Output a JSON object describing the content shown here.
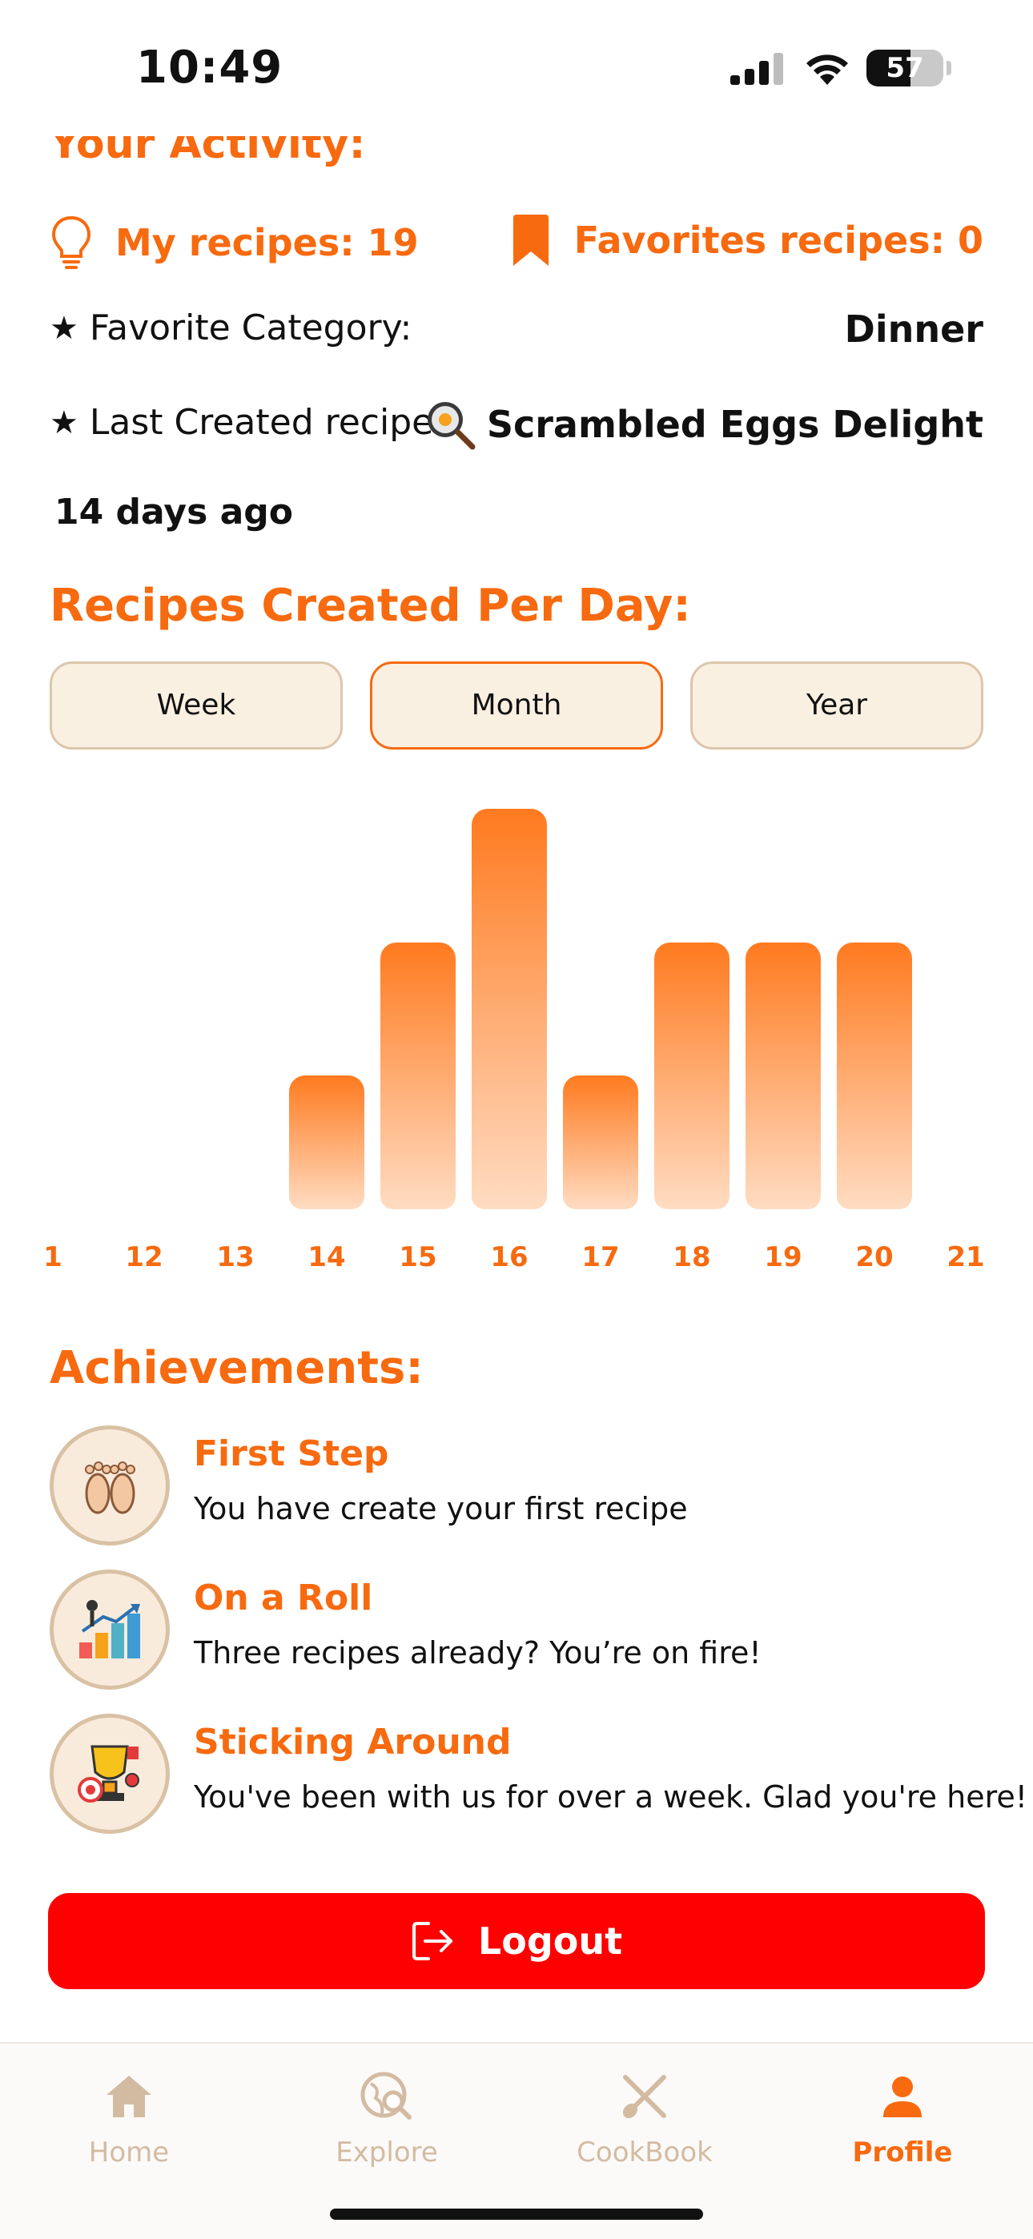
{
  "status_bar": {
    "time": "10:49",
    "battery": "57",
    "battery_level": 0.57
  },
  "activity": {
    "title": "Your Activity:",
    "my_recipes": "My recipes: 19",
    "favorites_recipes": "Favorites recipes: 0",
    "favorite_category_label": "Favorite Category:",
    "favorite_category_value": "Dinner",
    "last_created_label": "Last Created recipe:",
    "last_created_value": "Scrambled Eggs Delight",
    "last_created_ago": "14 days ago"
  },
  "chart_section": {
    "title": "Recipes Created Per Day:",
    "tabs": [
      "Week",
      "Month",
      "Year"
    ],
    "active_tab": "Month"
  },
  "chart_data": {
    "type": "bar",
    "categories": [
      "1",
      "12",
      "13",
      "14",
      "15",
      "16",
      "17",
      "18",
      "19",
      "20",
      "21"
    ],
    "values": [
      0,
      0,
      0,
      1,
      2,
      3,
      1,
      2,
      2,
      2,
      0
    ],
    "ylim": [
      0,
      3
    ],
    "grid": false,
    "colors": {
      "top": "#FF7A1F",
      "bottom": "#FFDCC2"
    }
  },
  "achievements": {
    "title": "Achievements:",
    "items": [
      {
        "title": "First Step",
        "desc": "You have create your first recipe",
        "icon": "footprints-icon"
      },
      {
        "title": "On a Roll",
        "desc": "Three recipes already? You’re on fire!",
        "icon": "growth-chart-icon"
      },
      {
        "title": "Sticking Around",
        "desc": "You've been with us for over a week. Glad you're here!",
        "icon": "trophy-icon"
      }
    ]
  },
  "logout": {
    "label": "Logout",
    "icon": "logout-icon",
    "color": "#FF0000"
  },
  "tabbar": {
    "items": [
      {
        "label": "Home",
        "icon": "home-icon"
      },
      {
        "label": "Explore",
        "icon": "explore-icon"
      },
      {
        "label": "CookBook",
        "icon": "cookbook-icon"
      },
      {
        "label": "Profile",
        "icon": "profile-icon"
      }
    ],
    "active": "Profile"
  },
  "colors": {
    "accent": "#F76A0F",
    "tab_bg": "#FAF0E2",
    "inactive_nav": "#D3BBA2"
  }
}
